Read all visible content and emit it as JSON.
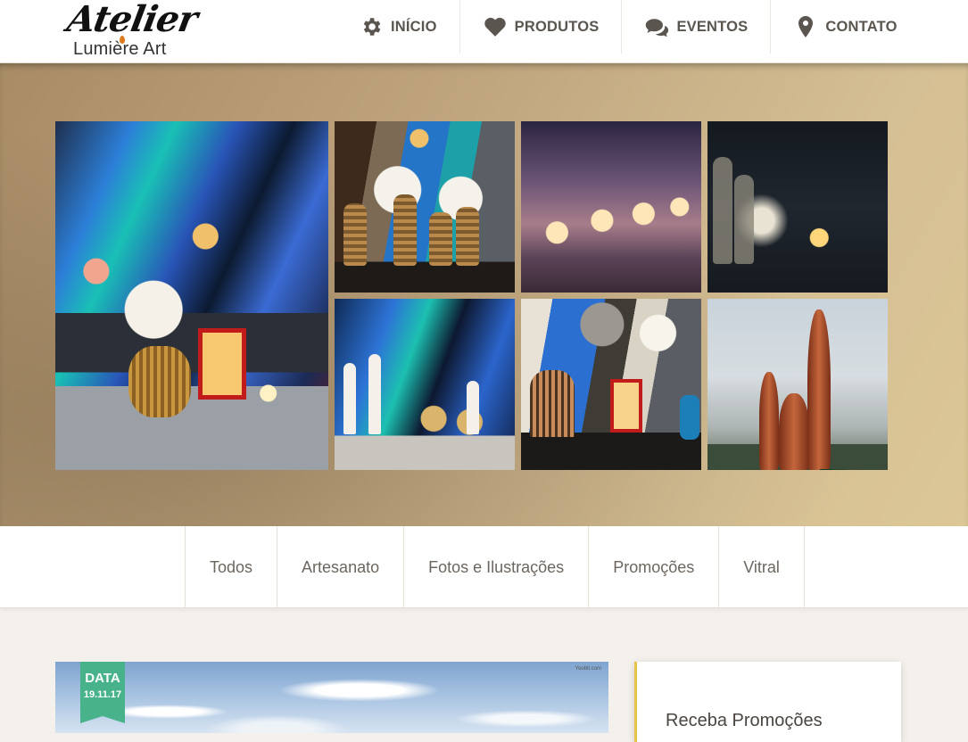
{
  "brand": {
    "logo_script": "Atelier",
    "logo_sub": "Lumière Art"
  },
  "nav": [
    {
      "label": "INÍCIO",
      "icon": "gear-icon"
    },
    {
      "label": "PRODUTOS",
      "icon": "heart-icon"
    },
    {
      "label": "EVENTOS",
      "icon": "chat-icon"
    },
    {
      "label": "CONTATO",
      "icon": "map-pin-icon"
    }
  ],
  "gallery": {
    "images": [
      "flowers-lantern-painting",
      "orchids-vases",
      "bottles-candles",
      "dark-lanterns",
      "candles-abstract-art",
      "birdcage-lanterns",
      "ceramic-vases-outdoor"
    ]
  },
  "categories": [
    "Todos",
    "Artesanato",
    "Fotos e Ilustrações",
    "Promoções",
    "Vitral"
  ],
  "post": {
    "badge_label": "DATA",
    "badge_date": "19.11.17",
    "watermark": "Yoobit.com"
  },
  "sidebar": {
    "title": "Receba Promoções"
  },
  "colors": {
    "accent_green": "#48b38a",
    "accent_gold": "#e8c34a",
    "nav_text": "#5a554f"
  }
}
